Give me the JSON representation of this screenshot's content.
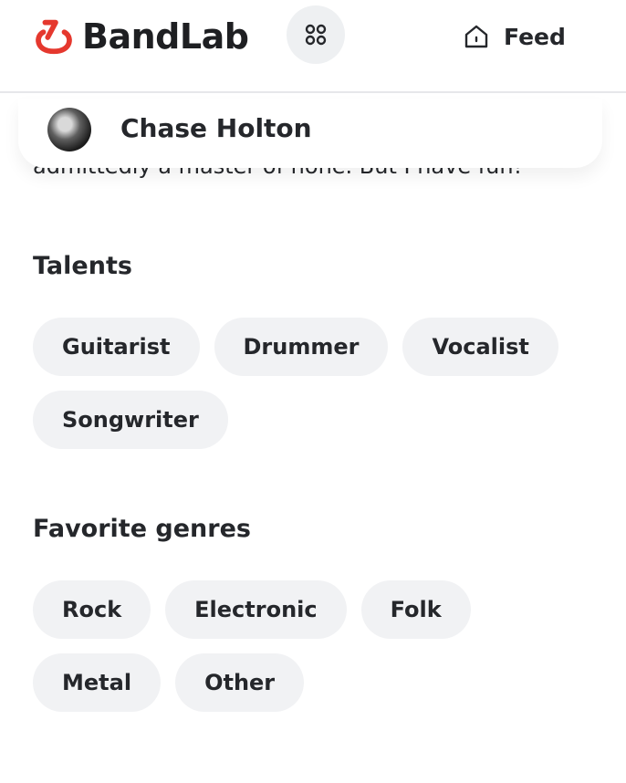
{
  "header": {
    "brand": "BandLab",
    "feed_label": "Feed",
    "brand_color": "#e5382e",
    "icons": {
      "logo": "bandlab-logo-icon",
      "apps": "apps-grid-icon",
      "feed": "home-icon"
    }
  },
  "profile": {
    "name": "Chase Holton",
    "bio_fragment": "admittedly a master of none. But I have fun!"
  },
  "talents": {
    "title": "Talents",
    "items": [
      "Guitarist",
      "Drummer",
      "Vocalist",
      "Songwriter"
    ]
  },
  "genres": {
    "title": "Favorite genres",
    "items": [
      "Rock",
      "Electronic",
      "Folk",
      "Metal",
      "Other"
    ]
  }
}
